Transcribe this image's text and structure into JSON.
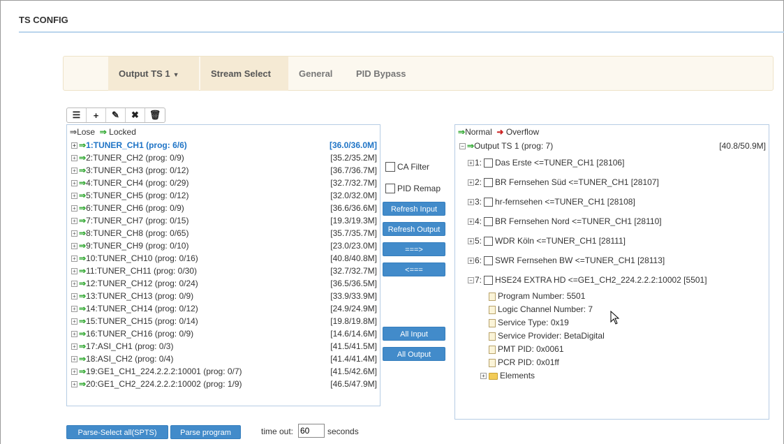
{
  "page": {
    "title": "TS CONFIG"
  },
  "tabs": {
    "output": "Output TS 1",
    "stream_select": "Stream Select",
    "general": "General",
    "pid_bypass": "PID Bypass"
  },
  "toolbar": {
    "list": "☰",
    "add": "+",
    "edit": "✎",
    "delete": "✖",
    "trash": "🗑"
  },
  "left_panel": {
    "legend_lose": "Lose",
    "legend_locked": "Locked",
    "items": [
      {
        "label": "1:TUNER_CH1 (prog: 6/6)",
        "rate": "[36.0/36.0M]"
      },
      {
        "label": "2:TUNER_CH2 (prog: 0/9)",
        "rate": "[35.2/35.2M]"
      },
      {
        "label": "3:TUNER_CH3 (prog: 0/12)",
        "rate": "[36.7/36.7M]"
      },
      {
        "label": "4:TUNER_CH4 (prog: 0/29)",
        "rate": "[32.7/32.7M]"
      },
      {
        "label": "5:TUNER_CH5 (prog: 0/12)",
        "rate": "[32.0/32.0M]"
      },
      {
        "label": "6:TUNER_CH6 (prog: 0/9)",
        "rate": "[36.6/36.6M]"
      },
      {
        "label": "7:TUNER_CH7 (prog: 0/15)",
        "rate": "[19.3/19.3M]"
      },
      {
        "label": "8:TUNER_CH8 (prog: 0/65)",
        "rate": "[35.7/35.7M]"
      },
      {
        "label": "9:TUNER_CH9 (prog: 0/10)",
        "rate": "[23.0/23.0M]"
      },
      {
        "label": "10:TUNER_CH10 (prog: 0/16)",
        "rate": "[40.8/40.8M]"
      },
      {
        "label": "11:TUNER_CH11 (prog: 0/30)",
        "rate": "[32.7/32.7M]"
      },
      {
        "label": "12:TUNER_CH12 (prog: 0/24)",
        "rate": "[36.5/36.5M]"
      },
      {
        "label": "13:TUNER_CH13 (prog: 0/9)",
        "rate": "[33.9/33.9M]"
      },
      {
        "label": "14:TUNER_CH14 (prog: 0/12)",
        "rate": "[24.9/24.9M]"
      },
      {
        "label": "15:TUNER_CH15 (prog: 0/14)",
        "rate": "[19.8/19.8M]"
      },
      {
        "label": "16:TUNER_CH16 (prog: 0/9)",
        "rate": "[14.6/14.6M]"
      },
      {
        "label": "17:ASI_CH1 (prog: 0/3)",
        "rate": "[41.5/41.5M]"
      },
      {
        "label": "18:ASI_CH2 (prog: 0/4)",
        "rate": "[41.4/41.4M]"
      },
      {
        "label": "19:GE1_CH1_224.2.2.2:10001 (prog: 0/7)",
        "rate": "[41.5/42.6M]"
      },
      {
        "label": "20:GE1_CH2_224.2.2.2:10002 (prog: 1/9)",
        "rate": "[46.5/47.9M]"
      }
    ]
  },
  "middle": {
    "ca_filter": "CA Filter",
    "pid_remap": "PID Remap",
    "refresh_input": "Refresh Input",
    "refresh_output": "Refresh Output",
    "forward": "===>",
    "backward": "<===",
    "all_input": "All Input",
    "all_output": "All Output"
  },
  "right_panel": {
    "legend_normal": "Normal",
    "legend_overflow": "Overflow",
    "root_label": "Output TS 1 (prog: 7)",
    "root_rate": "[40.8/50.9M]",
    "services": [
      {
        "num": "1:",
        "label": "Das Erste <=TUNER_CH1 [28106]"
      },
      {
        "num": "2:",
        "label": "BR Fernsehen Süd <=TUNER_CH1 [28107]"
      },
      {
        "num": "3:",
        "label": "hr-fernsehen <=TUNER_CH1 [28108]"
      },
      {
        "num": "4:",
        "label": "BR Fernsehen Nord <=TUNER_CH1 [28110]"
      },
      {
        "num": "5:",
        "label": "WDR Köln <=TUNER_CH1 [28111]"
      },
      {
        "num": "6:",
        "label": "SWR Fernsehen BW <=TUNER_CH1 [28113]"
      },
      {
        "num": "7:",
        "label": "HSE24 EXTRA HD <=GE1_CH2_224.2.2.2:10002 [5501]"
      }
    ],
    "properties": [
      "Program Number: 5501",
      "Logic Channel Number: 7",
      "Service Type: 0x19",
      "Service Provider: BetaDigital",
      "PMT PID: 0x0061",
      "PCR PID: 0x01ff"
    ],
    "elements": "Elements"
  },
  "bottom": {
    "parse_select_all": "Parse-Select all(SPTS)",
    "parse_program": "Parse program",
    "timeout_label": "time out:",
    "timeout_value": "60",
    "seconds": "seconds"
  }
}
